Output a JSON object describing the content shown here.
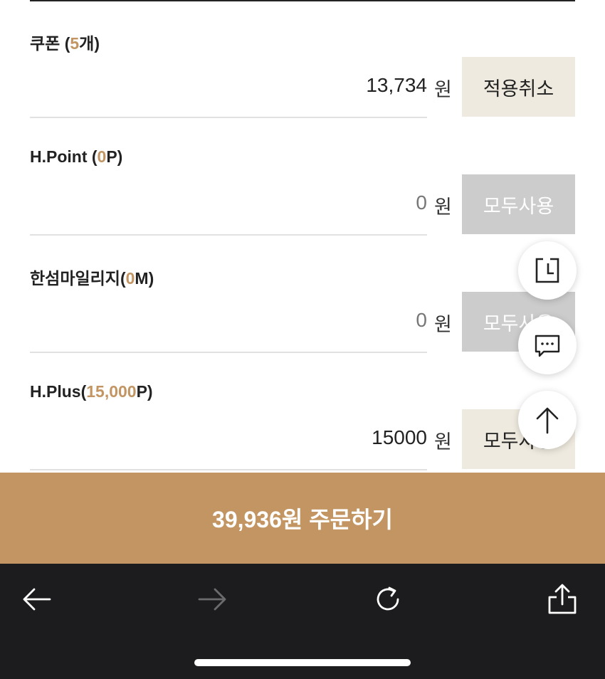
{
  "sections": [
    {
      "label": "쿠폰 (",
      "count": "5",
      "suffix": "개)",
      "amount": "13,734",
      "unit": "원",
      "button": "적용취소"
    },
    {
      "label": "H.Point (",
      "count": "0",
      "suffix": "P)",
      "amount": "0",
      "unit": "원",
      "button": "모두사용"
    },
    {
      "label": "한섬마일리지(",
      "count": "0",
      "suffix": "M)",
      "amount": "0",
      "unit": "원",
      "button": "모두사용"
    },
    {
      "label": "H.Plus(",
      "count": "15,000",
      "suffix": "P)",
      "amount": "15000",
      "unit": "원",
      "button": "모두사용"
    }
  ],
  "order": {
    "label": "39,936원 주문하기"
  },
  "colors": {
    "accent": "#c29562",
    "beige_button": "#efeadf",
    "disabled_button": "#cccccc",
    "browser_bar": "#1c1c1e"
  },
  "floating_buttons": [
    "recent-view-icon",
    "chat-icon",
    "scroll-top-icon"
  ],
  "browser_nav": [
    "back-arrow-icon",
    "forward-arrow-icon",
    "reload-icon",
    "share-icon"
  ]
}
